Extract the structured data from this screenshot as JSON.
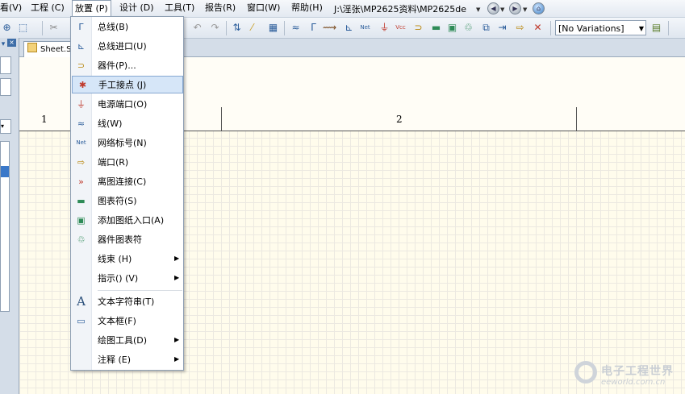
{
  "menubar": {
    "items": [
      {
        "label": "看(V)"
      },
      {
        "label": "工程 (C)"
      },
      {
        "label": "放置 (P)"
      },
      {
        "label": "设计 (D)"
      },
      {
        "label": "工具(T)"
      },
      {
        "label": "报告(R)"
      },
      {
        "label": "窗口(W)"
      },
      {
        "label": "帮助(H)"
      }
    ],
    "path": "J:\\淫张\\MP2625资料\\MP2625de"
  },
  "toolbar": {
    "variations": "[No Variations]"
  },
  "tabs": {
    "doc_tab": "Sheet.S"
  },
  "sheet": {
    "zones": [
      "1",
      "2"
    ]
  },
  "place_menu": {
    "items": [
      {
        "label": "总线(B)",
        "icon": "bus-icon"
      },
      {
        "label": "总线进口(U)",
        "icon": "bus-entry-icon"
      },
      {
        "label": "器件(P)...",
        "icon": "part-icon"
      },
      {
        "label": "手工接点 (J)",
        "icon": "junction-icon",
        "highlighted": true
      },
      {
        "label": "电源端口(O)",
        "icon": "power-port-icon"
      },
      {
        "label": "线(W)",
        "icon": "wire-icon"
      },
      {
        "label": "网络标号(N)",
        "icon": "net-label-icon"
      },
      {
        "label": "端口(R)",
        "icon": "port-icon"
      },
      {
        "label": "离图连接(C)",
        "icon": "off-sheet-connector-icon"
      },
      {
        "label": "图表符(S)",
        "icon": "sheet-symbol-icon"
      },
      {
        "label": "添加图纸入口(A)",
        "icon": "sheet-entry-icon"
      },
      {
        "label": "器件图表符",
        "icon": "device-sheet-symbol-icon"
      },
      {
        "label": "线束 (H)",
        "submenu": true
      },
      {
        "label": "指示() (V)",
        "submenu": true
      },
      {
        "label": "文本字符串(T)",
        "icon": "text-string-icon"
      },
      {
        "label": "文本框(F)",
        "icon": "text-frame-icon"
      },
      {
        "label": "绘图工具(D)",
        "submenu": true
      },
      {
        "label": "注释 (E)",
        "submenu": true
      }
    ]
  },
  "watermark": {
    "cn": "电子工程世界",
    "en": "eeworld.com.cn"
  },
  "colors": {
    "highlight_bg": "#d6e6f8",
    "highlight_border": "#86a8d2",
    "sheet_bg": "#fffcec",
    "selection": "#3a78c9"
  }
}
